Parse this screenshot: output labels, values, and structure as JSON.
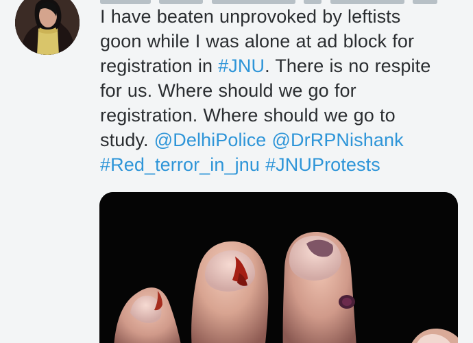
{
  "tweet": {
    "lines": [
      [
        {
          "text": "I have beaten unprovoked by leftists",
          "kind": "plain"
        }
      ],
      [
        {
          "text": "goon  while I was alone at ad block for",
          "kind": "plain"
        }
      ],
      [
        {
          "text": "registration in ",
          "kind": "plain"
        },
        {
          "text": "#JNU",
          "kind": "link"
        },
        {
          "text": ". There is no respite",
          "kind": "plain"
        }
      ],
      [
        {
          "text": "for us. Where should we go for",
          "kind": "plain"
        }
      ],
      [
        {
          "text": "registration. Where should we go to",
          "kind": "plain"
        }
      ],
      [
        {
          "text": "study. ",
          "kind": "plain"
        },
        {
          "text": "@DelhiPolice",
          "kind": "link"
        },
        {
          "text": " ",
          "kind": "plain"
        },
        {
          "text": "@DrRPNishank",
          "kind": "link"
        }
      ],
      [
        {
          "text": "#Red_terror_in_jnu",
          "kind": "link"
        },
        {
          "text": "  ",
          "kind": "plain"
        },
        {
          "text": "#JNUProtests",
          "kind": "link"
        }
      ]
    ],
    "colors": {
      "text": "#2a2d30",
      "link": "#2e95d8",
      "background": "#f3f5f6"
    },
    "media": {
      "icon": "photo-icon"
    }
  }
}
